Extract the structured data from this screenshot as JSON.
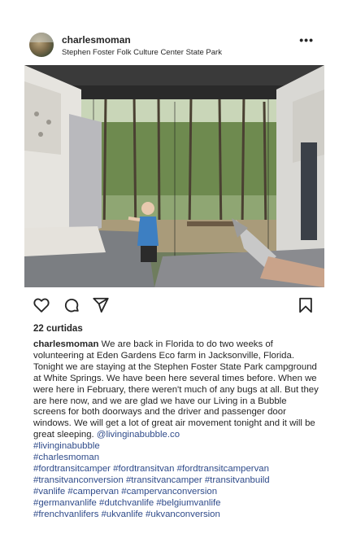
{
  "post": {
    "username": "charlesmoman",
    "location": "Stephen Foster Folk Culture Center State Park",
    "more_label": "•••",
    "likes": "22 curtidas",
    "caption": {
      "author": "charlesmoman",
      "text": "We are back in Florida to do two weeks of volunteering at Eden Gardens Eco farm in Jacksonville, Florida. Tonight we are staying at the Stephen Foster State Park campground at White Springs. We have been here several times before. When we were here in February, there weren't much of any bugs at all. But they are here now, and we are glad we have our Living in a Bubble screens for both doorways and the driver and passenger door windows. We will get a lot of great air movement tonight and it will be great sleeping.",
      "mention": "@livinginabubble.co",
      "hashtag_lines": [
        "#livinginabubble",
        "#charlesmoman",
        "#fordtransitcamper #fordtransitvan #fordtransitcampervan",
        "#transitvanconversion #transitvancamper #transitvanbuild",
        "#vanlife #campervan #campervanconversion",
        "#germanvanlife #dutchvanlife #belgiumvanlife",
        "#frenchvanlifers #ukvanlife #ukvanconversion"
      ]
    },
    "icons": {
      "like": "heart-icon",
      "comment": "comment-icon",
      "share": "send-icon",
      "save": "bookmark-icon"
    },
    "colors": {
      "text": "#262626",
      "hashtag": "#2f4b8a",
      "background": "#ffffff"
    }
  }
}
